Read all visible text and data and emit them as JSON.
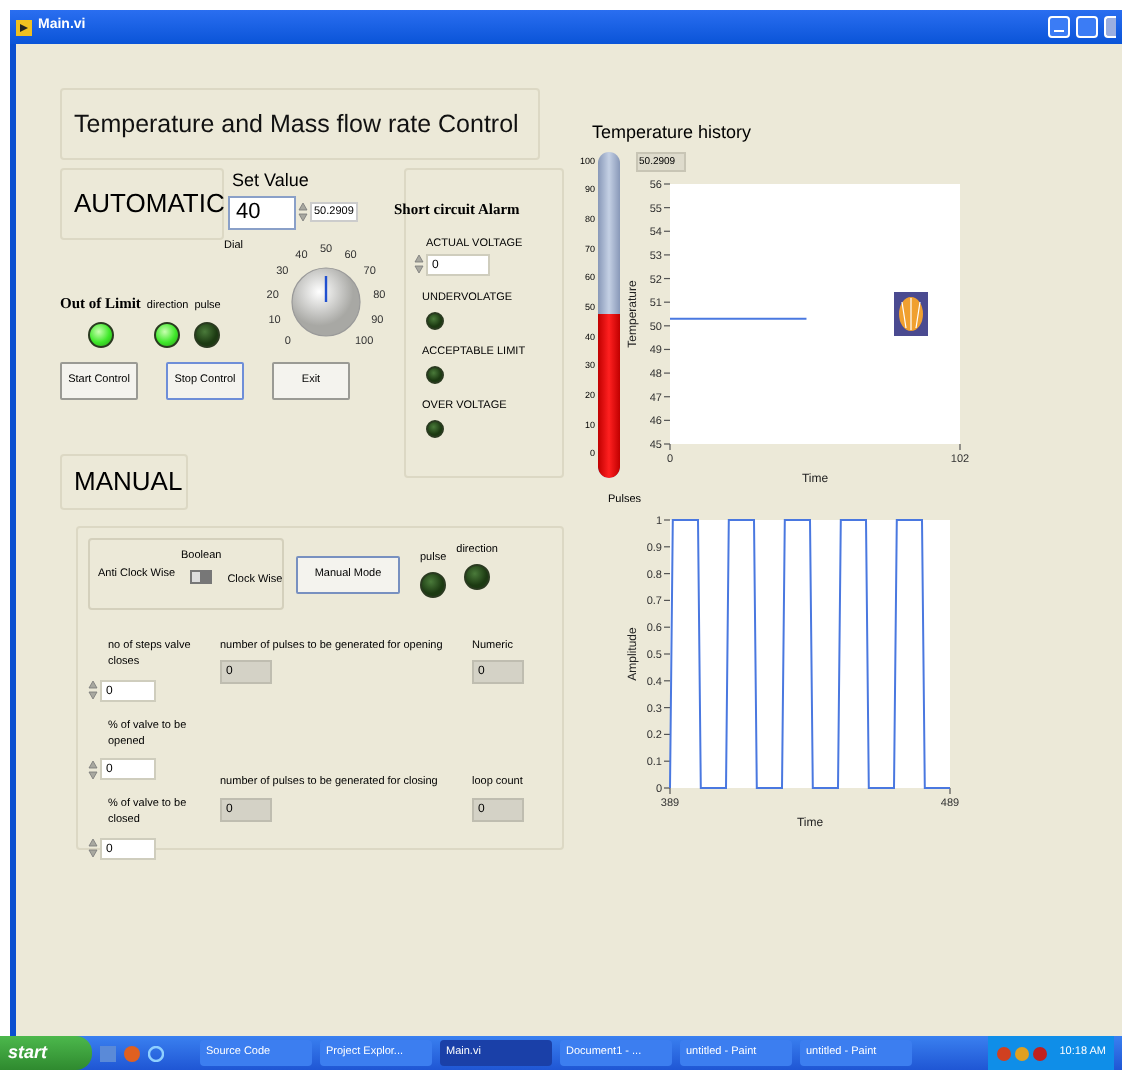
{
  "window": {
    "title": "Main.vi"
  },
  "panel_title": "Temperature and Mass flow rate Control",
  "automatic": {
    "label": "AUTOMATIC",
    "set_value": {
      "label": "Set Value",
      "value": "40",
      "readout": "50.2909"
    },
    "dial": {
      "label": "Dial",
      "level": 0.5,
      "scale": [
        "0",
        "10",
        "20",
        "30",
        "40",
        "50",
        "60",
        "70",
        "80",
        "90",
        "100"
      ]
    },
    "out_of_limit": {
      "label": "Out of Limit",
      "on": true
    },
    "leds": [
      {
        "label": "direction",
        "on": true
      },
      {
        "label": "pulse",
        "on": false
      }
    ],
    "buttons": [
      {
        "label": "Start Control",
        "focused": false
      },
      {
        "label": "Stop Control",
        "focused": true
      },
      {
        "label": "Exit",
        "focused": false
      }
    ]
  },
  "alarm": {
    "title": "Short circuit  Alarm",
    "voltage": {
      "label": "ACTUAL VOLTAGE",
      "value": "0"
    },
    "leds": [
      {
        "label": "UNDERVOLATGE",
        "on": false
      },
      {
        "label": "ACCEPTABLE LIMIT",
        "on": false
      },
      {
        "label": "OVER VOLTAGE",
        "on": false
      }
    ]
  },
  "temperature": {
    "title": "Temperature history",
    "readout": "50.2909",
    "thermometer": {
      "level": 0.503,
      "scale": [
        "100",
        "90",
        "80",
        "70",
        "60",
        "50",
        "40",
        "30",
        "20",
        "10",
        "0"
      ]
    },
    "chart_data": {
      "type": "line",
      "xlabel": "Time",
      "ylabel": "Temperature",
      "x": [
        0,
        48
      ],
      "xlim": [
        0,
        102
      ],
      "ylim": [
        45,
        56
      ],
      "xticks": [
        0,
        102
      ],
      "yticks": [
        45,
        46,
        47,
        48,
        49,
        50,
        51,
        52,
        53,
        54,
        55,
        56
      ],
      "series": [
        {
          "color": "#4a78e0",
          "values": [
            50.3,
            50.3
          ]
        }
      ]
    }
  },
  "pulses": {
    "chart_data": {
      "type": "line",
      "title": "Pulses",
      "xlabel": "Time",
      "ylabel": "Amplitude",
      "x": [
        389,
        390,
        399,
        400,
        409,
        410,
        419,
        420,
        429,
        430,
        439,
        440,
        449,
        450,
        459,
        460,
        469,
        470,
        479,
        480,
        489
      ],
      "xlim": [
        389,
        489
      ],
      "ylim": [
        0,
        1
      ],
      "xticks": [
        389,
        489
      ],
      "yticks": [
        0,
        0.1,
        0.2,
        0.3,
        0.4,
        0.5,
        0.6,
        0.7,
        0.8,
        0.9,
        1
      ],
      "series": [
        {
          "color": "#4a78e0",
          "values": [
            0,
            1,
            1,
            0,
            0,
            1,
            1,
            0,
            0,
            1,
            1,
            0,
            0,
            1,
            1,
            0,
            0,
            1,
            1,
            0,
            0
          ]
        }
      ]
    }
  },
  "manual": {
    "label": "MANUAL",
    "switch": {
      "label": "Boolean",
      "left": "Anti Clock Wise",
      "right": "Clock Wise",
      "on": false
    },
    "mode_button": "Manual Mode",
    "leds": [
      {
        "label": "pulse",
        "on": false
      },
      {
        "label": "direction",
        "on": false
      }
    ],
    "controls": [
      {
        "label": "no of steps valve closes",
        "value": "0"
      },
      {
        "label": "% of valve to be opened",
        "value": "0"
      },
      {
        "label": "% of valve to be  closed",
        "value": "0"
      }
    ],
    "indicators": [
      {
        "label": "number of pulses to be generated for opening",
        "value": "0"
      },
      {
        "label": "Numeric",
        "value": "0"
      },
      {
        "label": "number of pulses to be generated for closing",
        "value": "0"
      },
      {
        "label": "loop count",
        "value": "0"
      }
    ]
  },
  "taskbar": {
    "start": "start",
    "tasks": [
      {
        "label": "Source Code",
        "selected": false
      },
      {
        "label": "Project Explor...",
        "selected": false
      },
      {
        "label": "Main.vi",
        "selected": true
      },
      {
        "label": "Document1 - ...",
        "selected": false
      },
      {
        "label": "untitled - Paint",
        "selected": false
      },
      {
        "label": "untitled - Paint",
        "selected": false
      }
    ],
    "clock": "10:18 AM"
  }
}
